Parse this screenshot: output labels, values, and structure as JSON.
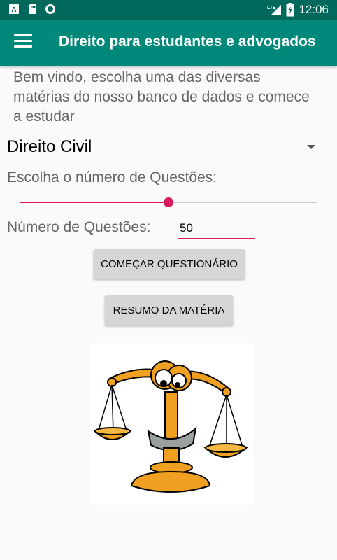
{
  "status_bar": {
    "time": "12:06",
    "network": "LTE",
    "icons": [
      "a-notification-icon",
      "sd-card-icon",
      "sync-circle-icon",
      "lte-signal-icon",
      "battery-charging-icon"
    ]
  },
  "app_bar": {
    "title": "Direito para estudantes e advogados",
    "menu_icon": "hamburger-menu-icon",
    "color": "#00897b",
    "status_color": "#00695c"
  },
  "main": {
    "welcome_text": "Bem vindo, escolha uma das diversas matérias do nosso banco de dados e comece a estudar",
    "subject_select": {
      "selected": "Direito Civil",
      "icon": "dropdown-arrow-icon"
    },
    "choose_label": "Escolha o número de Questões:",
    "slider": {
      "value": 50,
      "max": 100,
      "color": "#d81b60"
    },
    "num_label": "Número de Questões:",
    "num_value": "50",
    "start_button": "COMEÇAR QUESTIONÁRIO",
    "summary_button": "RESUMO DA MATÉRIA",
    "illustration": "justice-scale-cartoon-icon"
  }
}
